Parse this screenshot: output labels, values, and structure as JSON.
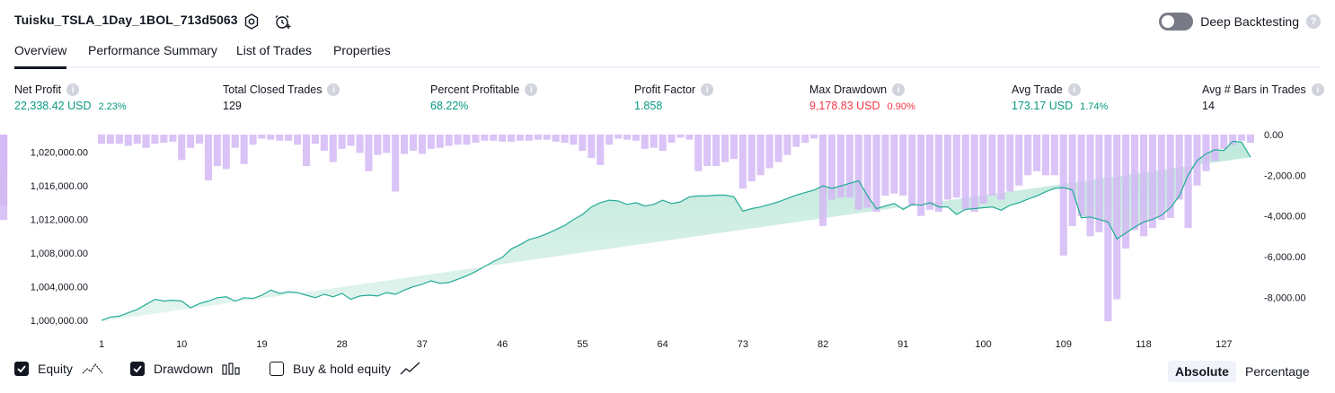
{
  "strategy": {
    "title": "Tuisku_TSLA_1Day_1BOL_713d5063",
    "settings_icon": "gear-icon",
    "alert_icon": "alarm-clock-plus-icon"
  },
  "deep_backtesting": {
    "label": "Deep Backtesting",
    "enabled": false,
    "help": "?"
  },
  "tabs": [
    {
      "label": "Overview",
      "active": true
    },
    {
      "label": "Performance Summary",
      "active": false
    },
    {
      "label": "List of Trades",
      "active": false
    },
    {
      "label": "Properties",
      "active": false
    }
  ],
  "metrics": [
    {
      "label": "Net Profit",
      "value": "22,338.42 USD",
      "pct": "2.23%",
      "color": "#089981"
    },
    {
      "label": "Total Closed Trades",
      "value": "129",
      "pct": "",
      "color": "#131722"
    },
    {
      "label": "Percent Profitable",
      "value": "68.22%",
      "pct": "",
      "color": "#089981"
    },
    {
      "label": "Profit Factor",
      "value": "1.858",
      "pct": "",
      "color": "#089981"
    },
    {
      "label": "Max Drawdown",
      "value": "9,178.83 USD",
      "pct": "0.90%",
      "color": "#f23645"
    },
    {
      "label": "Avg Trade",
      "value": "173.17 USD",
      "pct": "1.74%",
      "color": "#089981"
    },
    {
      "label": "Avg # Bars in Trades",
      "value": "14",
      "pct": "",
      "color": "#131722"
    }
  ],
  "legend": {
    "equity": {
      "label": "Equity",
      "checked": true
    },
    "drawdown": {
      "label": "Drawdown",
      "checked": true
    },
    "buy_hold": {
      "label": "Buy & hold equity",
      "checked": false
    }
  },
  "view_mode": {
    "absolute": "Absolute",
    "percentage": "Percentage",
    "selected": "Absolute"
  },
  "colors": {
    "equity_line": "#22ab94",
    "equity_fill": "#c8ece2",
    "drawdown_bar": "#d4b8f5",
    "drawdown_overlap": "#b0b6e3"
  },
  "chart_data": {
    "type": "area",
    "x_ticks": [
      "1",
      "10",
      "19",
      "28",
      "37",
      "46",
      "55",
      "64",
      "73",
      "82",
      "91",
      "100",
      "109",
      "118",
      "127"
    ],
    "left_axis_ticks": [
      "1,020,000.00",
      "1,016,000.00",
      "1,012,000.00",
      "1,008,000.00",
      "1,004,000.00",
      "1,000,000.00"
    ],
    "right_axis_ticks": [
      "0.00",
      "-2,000.00",
      "-4,000.00",
      "-6,000.00",
      "-8,000.00"
    ],
    "left_ylim": [
      999900,
      1022100
    ],
    "right_ylim": [
      -9178.83,
      0
    ],
    "x": [
      1,
      2,
      3,
      4,
      5,
      6,
      7,
      8,
      9,
      10,
      11,
      12,
      13,
      14,
      15,
      16,
      17,
      18,
      19,
      20,
      21,
      22,
      23,
      24,
      25,
      26,
      27,
      28,
      29,
      30,
      31,
      32,
      33,
      34,
      35,
      36,
      37,
      38,
      39,
      40,
      41,
      42,
      43,
      44,
      45,
      46,
      47,
      48,
      49,
      50,
      51,
      52,
      53,
      54,
      55,
      56,
      57,
      58,
      59,
      60,
      61,
      62,
      63,
      64,
      65,
      66,
      67,
      68,
      69,
      70,
      71,
      72,
      73,
      74,
      75,
      76,
      77,
      78,
      79,
      80,
      81,
      82,
      83,
      84,
      85,
      86,
      87,
      88,
      89,
      90,
      91,
      92,
      93,
      94,
      95,
      96,
      97,
      98,
      99,
      100,
      101,
      102,
      103,
      104,
      105,
      106,
      107,
      108,
      109,
      110,
      111,
      112,
      113,
      114,
      115,
      116,
      117,
      118,
      119,
      120,
      121,
      122,
      123,
      124,
      125,
      126,
      127,
      128,
      129,
      130
    ],
    "series": [
      {
        "name": "Equity",
        "axis": "left",
        "values": [
          1000000,
          1000400,
          1000500,
          1000900,
          1001300,
          1001900,
          1002500,
          1002300,
          1002400,
          1002300,
          1001500,
          1002000,
          1002300,
          1002700,
          1002800,
          1002300,
          1002700,
          1002600,
          1003000,
          1003600,
          1003200,
          1003400,
          1003300,
          1003000,
          1002700,
          1003100,
          1002800,
          1003200,
          1002500,
          1002900,
          1003000,
          1002900,
          1003300,
          1003100,
          1003600,
          1004000,
          1004300,
          1004700,
          1004400,
          1004500,
          1004900,
          1005300,
          1005800,
          1006400,
          1007000,
          1007500,
          1008500,
          1009000,
          1009600,
          1009900,
          1010300,
          1010800,
          1011300,
          1012000,
          1012600,
          1013500,
          1014000,
          1014300,
          1014200,
          1013800,
          1014000,
          1013600,
          1013800,
          1014300,
          1013900,
          1014100,
          1014700,
          1014800,
          1014800,
          1014900,
          1014900,
          1014700,
          1013000,
          1013300,
          1013500,
          1013800,
          1014100,
          1014500,
          1014900,
          1015200,
          1015500,
          1016000,
          1015700,
          1016000,
          1016300,
          1016600,
          1014800,
          1013300,
          1013600,
          1013900,
          1013200,
          1013800,
          1013700,
          1014000,
          1013500,
          1013500,
          1012600,
          1013200,
          1013300,
          1013400,
          1013500,
          1013100,
          1013700,
          1014000,
          1014400,
          1014800,
          1015300,
          1015700,
          1015800,
          1015500,
          1012200,
          1012300,
          1012000,
          1011700,
          1009700,
          1010400,
          1011100,
          1011700,
          1012000,
          1012500,
          1013400,
          1014800,
          1017300,
          1019000,
          1019800,
          1020300,
          1020200,
          1021300,
          1021200,
          1019400,
          1022100
        ]
      },
      {
        "name": "Drawdown",
        "axis": "right",
        "values": [
          -450,
          -450,
          -450,
          -550,
          -450,
          -650,
          -450,
          -400,
          -350,
          -1250,
          -650,
          -450,
          -2250,
          -1550,
          -1700,
          -650,
          -1450,
          -500,
          -200,
          -250,
          -300,
          -300,
          -500,
          -1550,
          -450,
          -800,
          -1350,
          -700,
          -550,
          -900,
          -1800,
          -1000,
          -900,
          -2800,
          -950,
          -800,
          -950,
          -700,
          -650,
          -550,
          -500,
          -500,
          -400,
          -300,
          -300,
          -350,
          -350,
          -300,
          -300,
          -250,
          -250,
          -350,
          -400,
          -500,
          -800,
          -1150,
          -1500,
          -500,
          -200,
          -250,
          -300,
          -700,
          -650,
          -800,
          -400,
          -150,
          -250,
          -1800,
          -1550,
          -1550,
          -1350,
          -1200,
          -2650,
          -2300,
          -2000,
          -1650,
          -1350,
          -1000,
          -600,
          -400,
          -200,
          -4500,
          -3200,
          -3100,
          -3100,
          -3700,
          -3600,
          -3800,
          -3000,
          -2900,
          -3000,
          -3500,
          -4000,
          -3700,
          -3800,
          -3200,
          -3100,
          -3700,
          -3800,
          -3400,
          -3000,
          -3200,
          -2800,
          -2500,
          -2000,
          -1800,
          -2000,
          -2000,
          -5950,
          -4500,
          -4000,
          -5000,
          -4800,
          -9178.83,
          -8100,
          -5600,
          -4700,
          -5000,
          -4600,
          -4200,
          -4100,
          -3200,
          -4600,
          -2500,
          -1800,
          -1300,
          -700,
          -500,
          -300,
          -400,
          -1700,
          -3500,
          -4200,
          0
        ]
      }
    ],
    "legend_position": "bottom-left",
    "grid": false
  }
}
